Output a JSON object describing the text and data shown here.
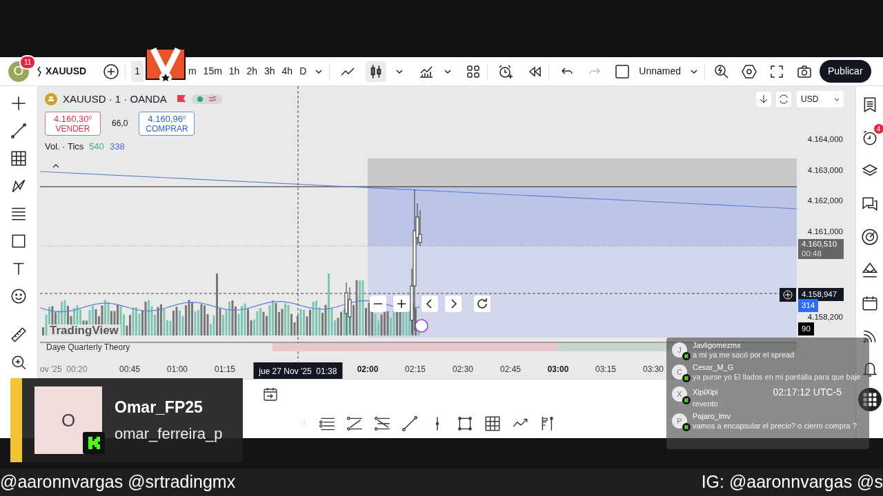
{
  "top_bar": {
    "avatar_initial": "O",
    "notification_count": "11",
    "symbol": "XAUUSD",
    "intervals": [
      {
        "label": "1",
        "selected": true
      },
      {
        "label": "m",
        "selected": false
      },
      {
        "label": "15m",
        "selected": false
      },
      {
        "label": "1h",
        "selected": false
      },
      {
        "label": "2h",
        "selected": false
      },
      {
        "label": "3h",
        "selected": false
      },
      {
        "label": "4h",
        "selected": false
      },
      {
        "label": "D",
        "selected": false
      }
    ],
    "layout_name": "Unnamed",
    "publish_label": "Publicar"
  },
  "chart": {
    "title": "XAUUSD · 1 · OANDA",
    "sell": {
      "price": "4.160,30$^{0}$",
      "label": "VENDER"
    },
    "spread": "66,0",
    "buy": {
      "price": "4.160,96$^{0}$",
      "label": "COMPRAR"
    },
    "volume_legend": {
      "label": "Vol. · Tics",
      "up": "540",
      "down": "338"
    },
    "currency": "USD",
    "brand": "TradingView",
    "indicator": "Daye Quarterly Theory",
    "price_ticks": [
      "4.164,000",
      "4.163,000",
      "4.162,000",
      "4.161,000",
      "4.158,200"
    ],
    "last_price": "4.160,510",
    "countdown": "00:48",
    "crosshair_price": "4.158,947",
    "volume_up": "314",
    "volume_down": "90",
    "cut_tick": "ov '25  00:20",
    "time_ticks": [
      {
        "label": "00:45",
        "major": false
      },
      {
        "label": "01:00",
        "major": false
      },
      {
        "label": "01:15",
        "major": false
      },
      {
        "label": "02:00",
        "major": true
      },
      {
        "label": "02:15",
        "major": false
      },
      {
        "label": "02:30",
        "major": false
      },
      {
        "label": "02:45",
        "major": false
      },
      {
        "label": "03:00",
        "major": true
      },
      {
        "label": "03:15",
        "major": false
      },
      {
        "label": "03:30",
        "major": false
      }
    ],
    "crosshair_time": "jue 27 Nov '25  01:38"
  },
  "sidebar_badge": "4",
  "streamer_card": {
    "initial": "O",
    "name": "Omar_FP25",
    "handle": "omar_ferreira_p"
  },
  "chat": {
    "timestamp": "02:17:12 UTC-5",
    "messages": [
      {
        "initial": "J",
        "user": "Javligomezmx",
        "text": "a mi ya me sacó por el spread"
      },
      {
        "initial": "C",
        "user": "Cesar_M_G",
        "text": "ya purse yo El llados en mi pantalla para que baje"
      },
      {
        "initial": "X",
        "user": "XipiXipi",
        "text": "revento"
      },
      {
        "initial": "P",
        "user": "Pajaro_lmv",
        "text": "vamos a encapsular el precio? o cierro compra ?"
      }
    ]
  },
  "ticker": {
    "left": "@aaronnvargas @srtradingmx",
    "right": "IG: @aaronnvargas @s"
  }
}
